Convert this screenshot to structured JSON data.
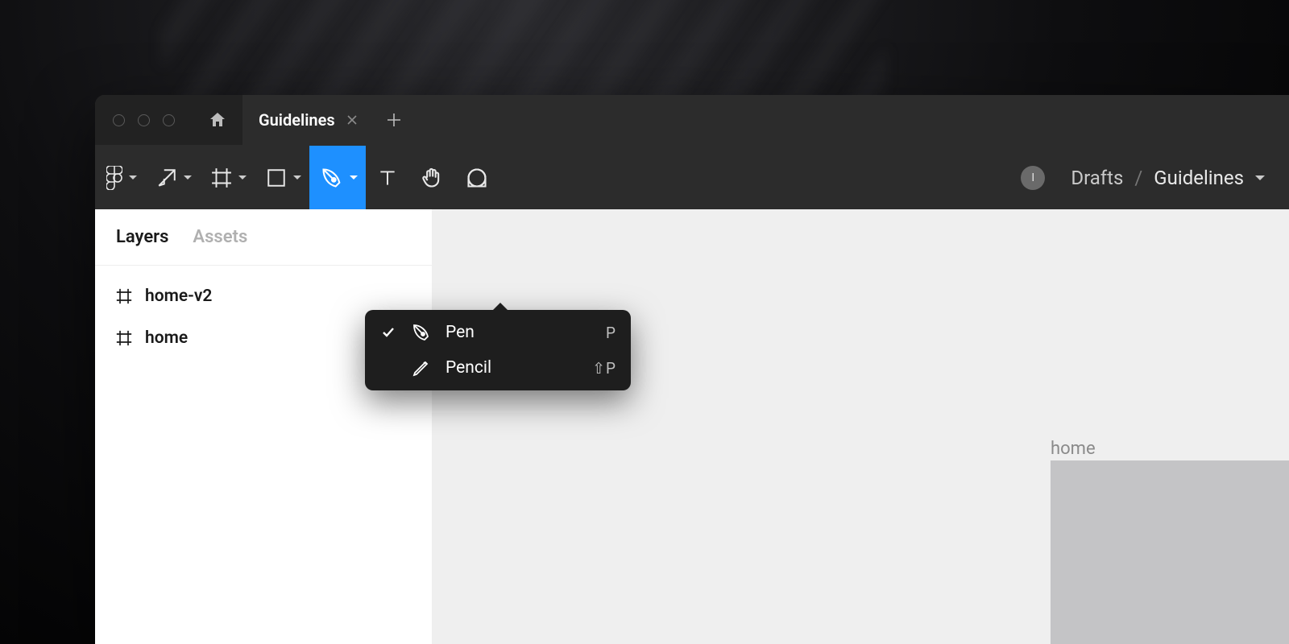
{
  "titlebar": {
    "tab_label": "Guidelines"
  },
  "breadcrumb": {
    "avatar_initial": "I",
    "location": "Drafts",
    "separator": "/",
    "file_name": "Guidelines"
  },
  "sidebar": {
    "tabs": {
      "layers": "Layers",
      "assets": "Assets"
    },
    "layers": [
      {
        "name": "home-v2"
      },
      {
        "name": "home"
      }
    ]
  },
  "canvas": {
    "frame_label": "home"
  },
  "dropdown": {
    "items": [
      {
        "label": "Pen",
        "shortcut": "P",
        "selected": true,
        "icon": "pen"
      },
      {
        "label": "Pencil",
        "shortcut": "⇧P",
        "selected": false,
        "icon": "pencil"
      }
    ]
  },
  "toolbar": {
    "tools": [
      "figma-menu",
      "move",
      "frame",
      "shape",
      "pen",
      "text",
      "hand",
      "comment"
    ],
    "active_tool": "pen"
  }
}
